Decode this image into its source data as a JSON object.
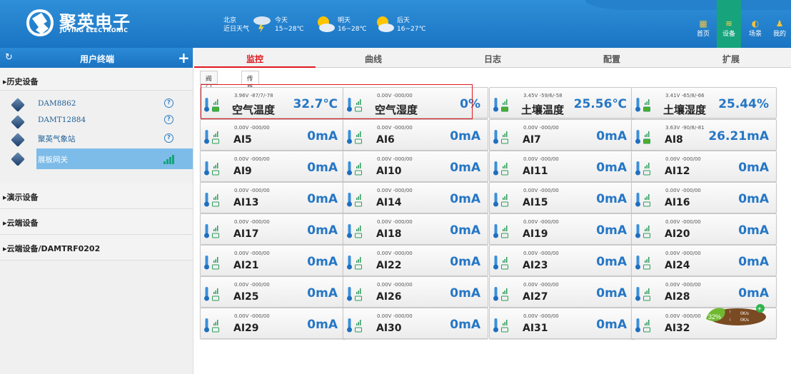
{
  "brand": {
    "name_cn": "聚英电子",
    "name_en": "JUYING ELECTRONIC"
  },
  "weather": [
    {
      "top": "北京",
      "bottom": "近日天气"
    },
    {
      "top": "今天",
      "bottom": "15~28℃"
    },
    {
      "top": "明天",
      "bottom": "16~28℃"
    },
    {
      "top": "后天",
      "bottom": "16~27℃"
    }
  ],
  "nav": [
    {
      "label": "首页",
      "icon": "home-icon"
    },
    {
      "label": "设备",
      "icon": "device-icon",
      "active": true
    },
    {
      "label": "场景",
      "icon": "scene-icon"
    },
    {
      "label": "我的",
      "icon": "user-icon"
    }
  ],
  "sidebar": {
    "title": "用户终端",
    "groups": [
      {
        "label": "▸历史设备",
        "devices": [
          {
            "label": "DAM8862",
            "status": "help"
          },
          {
            "label": "DAMT12884",
            "status": "help"
          },
          {
            "label": "聚英气象站",
            "status": "help"
          },
          {
            "label": "展板网关",
            "status": "signal",
            "selected": true
          }
        ]
      },
      {
        "label": "▸演示设备"
      },
      {
        "label": "▸云端设备"
      },
      {
        "label": "▸云端设备/DAMTRF0202"
      }
    ]
  },
  "tabs": [
    "监控",
    "曲线",
    "日志",
    "配置",
    "扩展"
  ],
  "subtabs": [
    "阀门控制器",
    "传感器"
  ],
  "tiles": [
    {
      "meta": "3.96V -87/7/-78",
      "name": "空气温度",
      "value": "32.7℃",
      "cn": true,
      "batt": "green"
    },
    {
      "meta": "0.00V -000/00",
      "name": "空气湿度",
      "value": "0%",
      "cn": true,
      "batt": "empty"
    },
    {
      "meta": "3.45V -59/6/-58",
      "name": "土壤温度",
      "value": "25.56℃",
      "cn": true,
      "batt": "green"
    },
    {
      "meta": "3.41V -65/8/-66",
      "name": "土壤湿度",
      "value": "25.44%",
      "cn": true,
      "batt": "green"
    },
    {
      "meta": "0.00V -000/00",
      "name": "AI5",
      "value": "0mA",
      "batt": "empty"
    },
    {
      "meta": "0.00V -000/00",
      "name": "AI6",
      "value": "0mA",
      "batt": "empty"
    },
    {
      "meta": "0.00V -000/00",
      "name": "AI7",
      "value": "0mA",
      "batt": "empty"
    },
    {
      "meta": "3.63V -90/8/-81",
      "name": "AI8",
      "value": "26.21mA",
      "batt": "green"
    },
    {
      "meta": "0.00V -000/00",
      "name": "AI9",
      "value": "0mA",
      "batt": "empty"
    },
    {
      "meta": "0.00V -000/00",
      "name": "AI10",
      "value": "0mA",
      "batt": "empty"
    },
    {
      "meta": "0.00V -000/00",
      "name": "AI11",
      "value": "0mA",
      "batt": "empty"
    },
    {
      "meta": "0.00V -000/00",
      "name": "AI12",
      "value": "0mA",
      "batt": "empty"
    },
    {
      "meta": "0.00V -000/00",
      "name": "AI13",
      "value": "0mA",
      "batt": "empty"
    },
    {
      "meta": "0.00V -000/00",
      "name": "AI14",
      "value": "0mA",
      "batt": "empty"
    },
    {
      "meta": "0.00V -000/00",
      "name": "AI15",
      "value": "0mA",
      "batt": "empty"
    },
    {
      "meta": "0.00V -000/00",
      "name": "AI16",
      "value": "0mA",
      "batt": "empty"
    },
    {
      "meta": "0.00V -000/00",
      "name": "AI17",
      "value": "0mA",
      "batt": "empty"
    },
    {
      "meta": "0.00V -000/00",
      "name": "AI18",
      "value": "0mA",
      "batt": "empty"
    },
    {
      "meta": "0.00V -000/00",
      "name": "AI19",
      "value": "0mA",
      "batt": "empty"
    },
    {
      "meta": "0.00V -000/00",
      "name": "AI20",
      "value": "0mA",
      "batt": "empty"
    },
    {
      "meta": "0.00V -000/00",
      "name": "AI21",
      "value": "0mA",
      "batt": "empty"
    },
    {
      "meta": "0.00V -000/00",
      "name": "AI22",
      "value": "0mA",
      "batt": "empty"
    },
    {
      "meta": "0.00V -000/00",
      "name": "AI23",
      "value": "0mA",
      "batt": "empty"
    },
    {
      "meta": "0.00V -000/00",
      "name": "AI24",
      "value": "0mA",
      "batt": "empty"
    },
    {
      "meta": "0.00V -000/00",
      "name": "AI25",
      "value": "0mA",
      "batt": "empty"
    },
    {
      "meta": "0.00V -000/00",
      "name": "AI26",
      "value": "0mA",
      "batt": "empty"
    },
    {
      "meta": "0.00V -000/00",
      "name": "AI27",
      "value": "0mA",
      "batt": "empty"
    },
    {
      "meta": "0.00V -000/00",
      "name": "AI28",
      "value": "0mA",
      "batt": "empty"
    },
    {
      "meta": "0.00V -000/00",
      "name": "AI29",
      "value": "0mA",
      "batt": "empty"
    },
    {
      "meta": "0.00V -000/00",
      "name": "AI30",
      "value": "0mA",
      "batt": "empty"
    },
    {
      "meta": "0.00V -000/00",
      "name": "AI31",
      "value": "0mA",
      "batt": "empty"
    },
    {
      "meta": "0.00V -000/00",
      "name": "AI32",
      "value": "",
      "batt": "empty"
    }
  ],
  "speed_widget": {
    "percent": "32%",
    "up": "0K/s",
    "down": "0K/s"
  },
  "colors": {
    "header": "#1a74c3",
    "accent": "#e0181e",
    "value": "#2577c6",
    "active_nav": "#17a37c",
    "selected_row": "#7dbbe9"
  }
}
